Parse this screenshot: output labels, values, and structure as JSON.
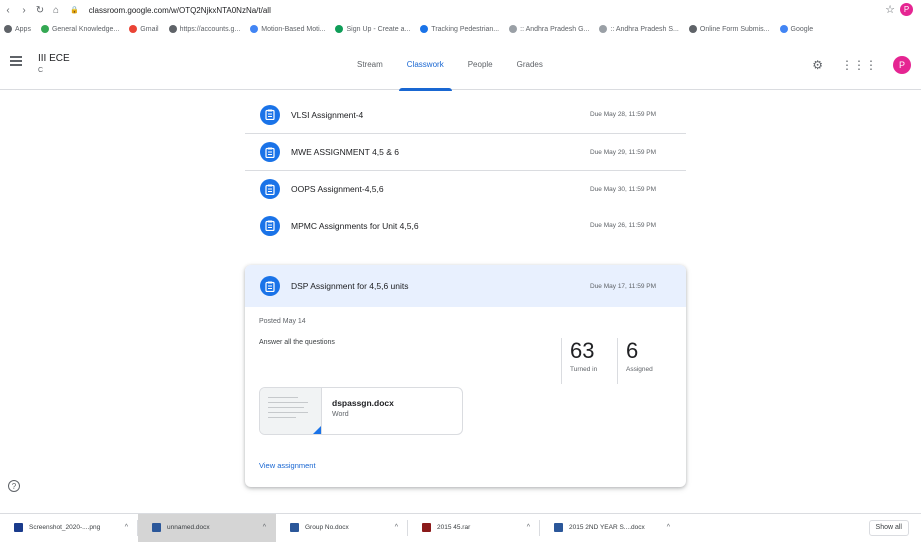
{
  "browser": {
    "url": "classroom.google.com/w/OTQ2NjkxNTA0NzNa/t/all",
    "bookmarks": [
      {
        "label": "Apps",
        "color": "#5f6368"
      },
      {
        "label": "General Knowledge...",
        "color": "#34a853"
      },
      {
        "label": "Gmail",
        "color": "#ea4335"
      },
      {
        "label": "https://accounts.g...",
        "color": "#5f6368"
      },
      {
        "label": "Motion-Based Moti...",
        "color": "#4285f4"
      },
      {
        "label": "Sign Up - Create a...",
        "color": "#0f9d58"
      },
      {
        "label": "Tracking Pedestrian...",
        "color": "#1a73e8"
      },
      {
        "label": ":: Andhra Pradesh G...",
        "color": "#9aa0a6"
      },
      {
        "label": ":: Andhra Pradesh S...",
        "color": "#9aa0a6"
      },
      {
        "label": "Online Form Submis...",
        "color": "#5f6368"
      },
      {
        "label": "Google",
        "color": "#4285f4"
      }
    ],
    "profile_initial": "P"
  },
  "header": {
    "class_name": "III ECE",
    "class_section": "C",
    "tabs": [
      {
        "label": "Stream",
        "active": false
      },
      {
        "label": "Classwork",
        "active": true
      },
      {
        "label": "People",
        "active": false
      },
      {
        "label": "Grades",
        "active": false
      }
    ],
    "avatar_initial": "P"
  },
  "assignments": [
    {
      "title": "VLSI Assignment-4",
      "due": "Due May 28, 11:59 PM"
    },
    {
      "title": "MWE ASSIGNMENT 4,5 & 6",
      "due": "Due May 29, 11:59 PM"
    },
    {
      "title": "OOPS Assignment-4,5,6",
      "due": "Due May 30, 11:59 PM"
    },
    {
      "title": "MPMC Assignments for Unit 4,5,6",
      "due": "Due May 26, 11:59 PM"
    }
  ],
  "expanded": {
    "title": "DSP Assignment for 4,5,6 units",
    "due": "Due May 17, 11:59 PM",
    "posted": "Posted May 14",
    "instructions": "Answer all the questions",
    "turned_in": "63",
    "turned_in_label": "Turned in",
    "assigned": "6",
    "assigned_label": "Assigned",
    "attachment_name": "dspassgn.docx",
    "attachment_type": "Word",
    "view_link": "View assignment"
  },
  "help_icon": "?",
  "downloads": [
    {
      "name": "Screenshot_2020-....png",
      "color": "#1a3b8c",
      "selected": false
    },
    {
      "name": "unnamed.docx",
      "color": "#2b579a",
      "selected": true
    },
    {
      "name": "Group No.docx",
      "color": "#2b579a",
      "selected": false
    },
    {
      "name": "2015 45.rar",
      "color": "#8b1a1a",
      "selected": false
    },
    {
      "name": "2015 2ND YEAR S....docx",
      "color": "#2b579a",
      "selected": false
    }
  ],
  "show_all_label": "Show all"
}
